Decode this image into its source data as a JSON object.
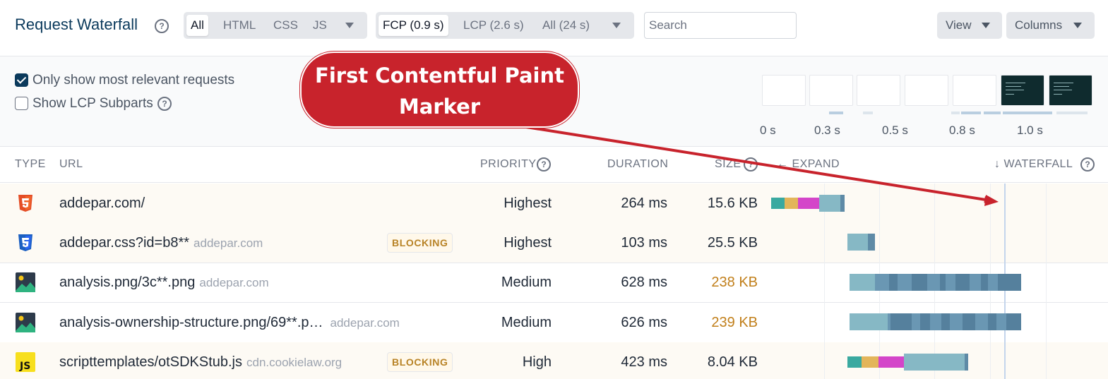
{
  "header": {
    "title": "Request Waterfall",
    "type_filter": {
      "options": [
        "All",
        "HTML",
        "CSS",
        "JS"
      ],
      "selected": "All"
    },
    "timing_filter": {
      "options": [
        "FCP (0.9 s)",
        "LCP (2.6 s)",
        "All (24 s)"
      ],
      "selected": "FCP (0.9 s)"
    },
    "search_placeholder": "Search",
    "view_label": "View",
    "columns_label": "Columns"
  },
  "options": {
    "relevant_label": "Only show most relevant requests",
    "relevant_checked": true,
    "lcp_label": "Show LCP Subparts",
    "lcp_checked": false
  },
  "filmstrip": {
    "time_labels": [
      "0 s",
      "0.3 s",
      "0.5 s",
      "0.8 s",
      "1.0 s"
    ]
  },
  "callout": {
    "line1": "First Contentful Paint",
    "line2": "Marker"
  },
  "table": {
    "columns": {
      "type": "TYPE",
      "url": "URL",
      "priority": "PRIORITY",
      "duration": "DURATION",
      "size": "SIZE",
      "expand": "EXPAND",
      "waterfall": "WATERFALL"
    },
    "rows": [
      {
        "type": "html",
        "url": "addepar.com/",
        "domain": "",
        "blocking": "",
        "priority": "Highest",
        "duration": "264 ms",
        "size": "15.6 KB",
        "size_warn": false
      },
      {
        "type": "css",
        "url": "addepar.css?id=b8**",
        "domain": "addepar.com",
        "blocking": "BLOCKING",
        "priority": "Highest",
        "duration": "103 ms",
        "size": "25.5 KB",
        "size_warn": false
      },
      {
        "type": "image",
        "url": "analysis.png/3c**.png",
        "domain": "addepar.com",
        "blocking": "",
        "priority": "Medium",
        "duration": "628 ms",
        "size": "238 KB",
        "size_warn": true
      },
      {
        "type": "image",
        "url": "analysis-ownership-structure.png/69**.p…",
        "domain": "addepar.com",
        "blocking": "",
        "priority": "Medium",
        "duration": "626 ms",
        "size": "239 KB",
        "size_warn": true
      },
      {
        "type": "js",
        "url": "scripttemplates/otSDKStub.js",
        "domain": "cdn.cookielaw.org",
        "blocking": "BLOCKING",
        "priority": "High",
        "duration": "423 ms",
        "size": "8.04 KB",
        "size_warn": false
      }
    ]
  },
  "colors": {
    "title": "#0b3a5c",
    "callout": "#c8232c",
    "blocking_text": "#b88326",
    "size_warning": "#c17f1a",
    "dns": "#3aa9a0",
    "connect": "#e3b55a",
    "ssl": "#d445c9",
    "wait": "#86b8c5",
    "download": "#5e8aa6"
  }
}
